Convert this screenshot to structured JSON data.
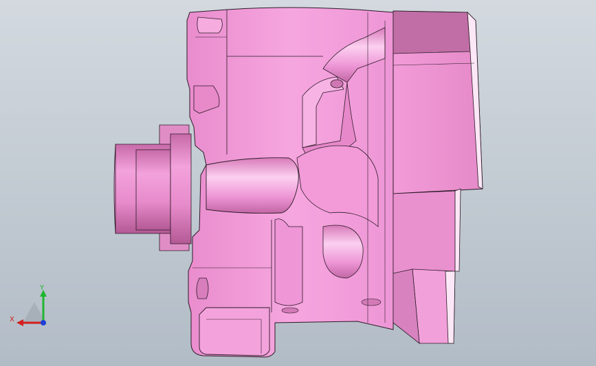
{
  "viewport": {
    "background_top": "#d3d9df",
    "background_bottom": "#b2bcc6"
  },
  "model": {
    "part_color": "#f29bd8",
    "part_shade": "#d77ab9",
    "part_dark": "#b75d9a",
    "part_light": "#fbc3ec",
    "edge_color": "#2a1a26"
  },
  "triad": {
    "x_label": "X",
    "y_label": "Y",
    "x_color": "#d42020",
    "y_color": "#1fb52f",
    "z_color": "#1f3fd6"
  }
}
